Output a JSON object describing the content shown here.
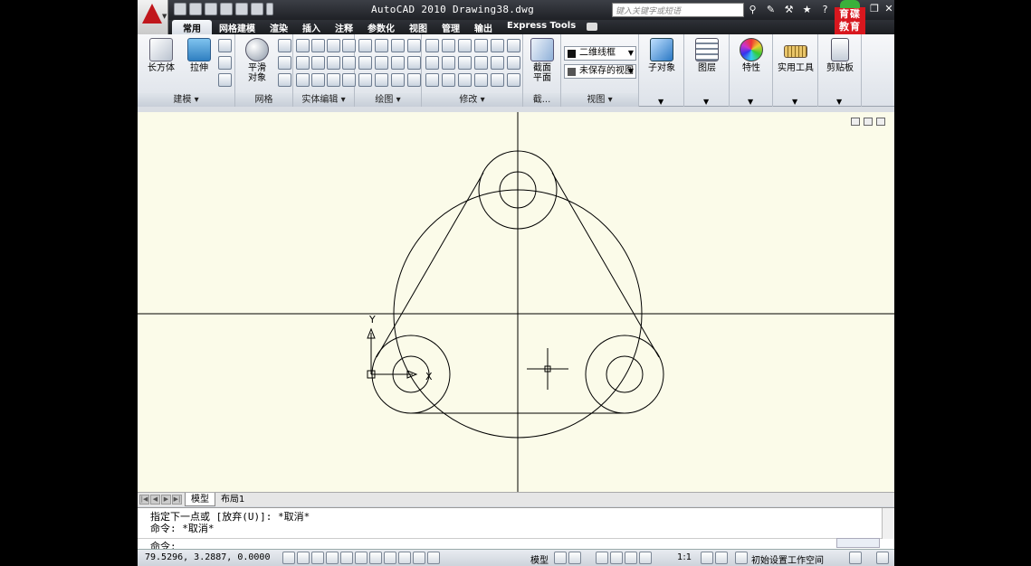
{
  "window": {
    "title": "AutoCAD 2010  Drawing38.dwg",
    "search_placeholder": "键入关键字或短语",
    "brand_badge_line1": "育碟",
    "brand_badge_line2": "教育"
  },
  "ribbon": {
    "tabs": [
      {
        "label": "常用",
        "active": true
      },
      {
        "label": "网格建模"
      },
      {
        "label": "渲染"
      },
      {
        "label": "插入"
      },
      {
        "label": "注释"
      },
      {
        "label": "参数化"
      },
      {
        "label": "视图"
      },
      {
        "label": "管理"
      },
      {
        "label": "输出"
      },
      {
        "label": "Express Tools"
      }
    ],
    "panels": {
      "modeling": {
        "label": "建模",
        "box_label": "长方体",
        "extrude_label": "拉伸"
      },
      "mesh": {
        "label": "网格",
        "smooth_label_1": "平滑",
        "smooth_label_2": "对象"
      },
      "solid_edit": {
        "label": "实体编辑"
      },
      "draw": {
        "label": "绘图"
      },
      "modify": {
        "label": "修改"
      },
      "section": {
        "label": "截...",
        "plane_label_1": "截面",
        "plane_label_2": "平面"
      },
      "view": {
        "label": "视图",
        "visual_style": "二维线框",
        "saved_view": "未保存的视图"
      },
      "subobject": {
        "label": "子对象"
      },
      "layers": {
        "label": "图层"
      },
      "properties": {
        "label": "特性"
      },
      "utilities": {
        "label": "实用工具"
      },
      "clipboard": {
        "label": "剪贴板"
      }
    }
  },
  "layout_tabs": {
    "model": "模型",
    "layout1": "布局1"
  },
  "command": {
    "line1": "指定下一点或 [放弃(U)]: *取消*",
    "line2": "命令: *取消*",
    "prompt": "命令:"
  },
  "status": {
    "coordinates": "79.5296, 3.2887, 0.0000",
    "model_label": "模型",
    "scale_label": "1:1",
    "workspace_label": "初始设置工作空间"
  },
  "ucs": {
    "x_label": "X",
    "y_label": "Y"
  },
  "colors": {
    "viewport_bg": "#fbfbe9",
    "linework": "#000000",
    "app_menu_red": "#c0161b"
  }
}
